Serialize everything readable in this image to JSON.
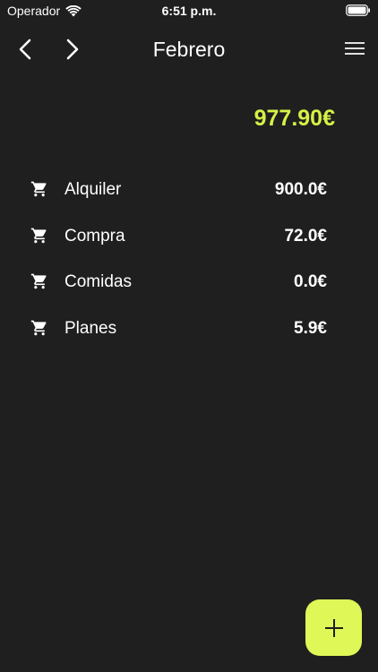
{
  "status_bar": {
    "carrier": "Operador",
    "time": "6:51 p.m."
  },
  "nav": {
    "title": "Febrero"
  },
  "summary": {
    "total": "977.90€"
  },
  "expenses": [
    {
      "icon": "cart-icon",
      "name": "Alquiler",
      "amount": "900.0€"
    },
    {
      "icon": "cart-icon",
      "name": "Compra",
      "amount": "72.0€"
    },
    {
      "icon": "cart-icon",
      "name": "Comidas",
      "amount": "0.0€"
    },
    {
      "icon": "cart-icon",
      "name": "Planes",
      "amount": "5.9€"
    }
  ],
  "colors": {
    "background": "#1f1f1f",
    "accent": "#d7f046",
    "fab": "#dff757",
    "text": "#ffffff"
  }
}
